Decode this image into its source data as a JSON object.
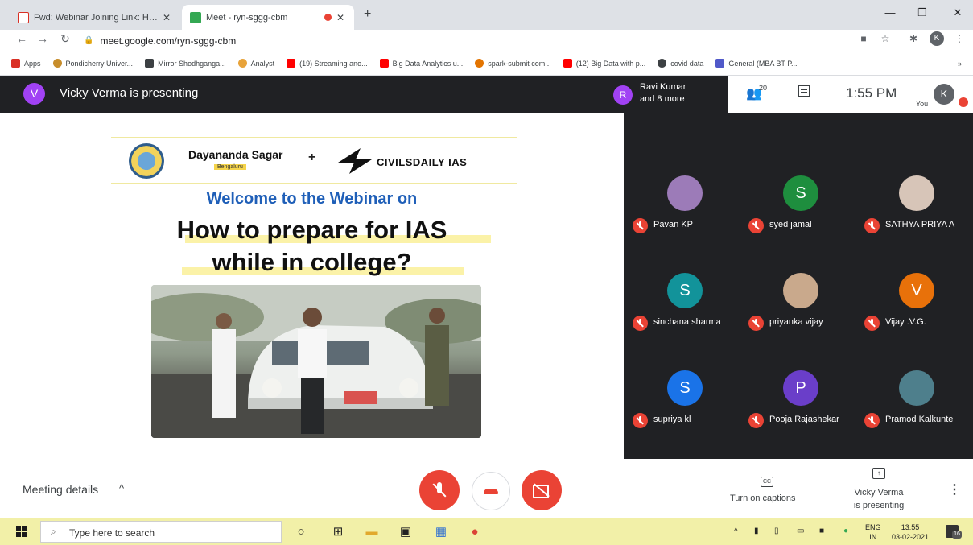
{
  "browser": {
    "tabs": [
      {
        "label": "Fwd: Webinar Joining Link: How t",
        "favicon": "gmail-icon"
      },
      {
        "label": "Meet - ryn-sggg-cbm",
        "favicon": "meet-icon",
        "recording": true
      }
    ],
    "new_tab_glyph": "+",
    "url": "meet.google.com/ryn-sggg-cbm",
    "profile_initial": "K",
    "bookmarks": [
      {
        "label": "Apps",
        "icon": "apps-grid-icon",
        "color": "#d93025"
      },
      {
        "label": "Pondicherry Univer...",
        "icon": "pondicherry-icon",
        "color": "#c78d2b"
      },
      {
        "label": "Mirror Shodhganga...",
        "icon": "shodhganga-icon",
        "color": "#3c4043"
      },
      {
        "label": "Analyst",
        "icon": "analyst-icon",
        "color": "#e8a33a"
      },
      {
        "label": "(19) Streaming ano...",
        "icon": "youtube-icon",
        "color": "#ff0000"
      },
      {
        "label": "Big Data Analytics u...",
        "icon": "youtube-icon",
        "color": "#ff0000"
      },
      {
        "label": "spark-submit com...",
        "icon": "spark-icon",
        "color": "#e37400"
      },
      {
        "label": "(12) Big Data with p...",
        "icon": "youtube-icon",
        "color": "#ff0000"
      },
      {
        "label": "covid data",
        "icon": "globe-icon",
        "color": "#3c4043"
      },
      {
        "label": "General (MBA BT P...",
        "icon": "teams-icon",
        "color": "#5059c9"
      }
    ],
    "bookmarks_more": "»"
  },
  "meet": {
    "presenter_initial": "V",
    "presenter_text": "Vicky Verma is presenting",
    "ravi_initial": "R",
    "ravi_line1": "Ravi Kumar",
    "ravi_line2": "and 8 more",
    "people_count": "20",
    "time": "1:55 PM",
    "you_label": "You",
    "you_initial": "K",
    "participants": [
      {
        "name": "Pavan KP",
        "initial": "",
        "color": "#9c7bb8",
        "photo": true
      },
      {
        "name": "syed jamal",
        "initial": "S",
        "color": "#1e8e3e",
        "photo": false
      },
      {
        "name": "SATHYA PRIYA A",
        "initial": "",
        "color": "#d7c5b8",
        "photo": true
      },
      {
        "name": "sinchana sharma",
        "initial": "S",
        "color": "#12939a",
        "photo": false
      },
      {
        "name": "priyanka vijay",
        "initial": "",
        "color": "#c9a98c",
        "photo": true
      },
      {
        "name": "Vijay .V.G.",
        "initial": "V",
        "color": "#e8710a",
        "photo": false
      },
      {
        "name": "supriya kl",
        "initial": "S",
        "color": "#1a73e8",
        "photo": false
      },
      {
        "name": "Pooja Rajashekar",
        "initial": "P",
        "color": "#6a3ec9",
        "photo": false
      },
      {
        "name": "Pramod Kalkunte",
        "initial": "",
        "color": "#4e7f8c",
        "photo": true
      }
    ],
    "meeting_details": "Meeting details",
    "details_chevron": "^",
    "captions_label": "Turn on captions",
    "cc_glyph": "CC",
    "present_line1": "Vicky Verma",
    "present_line2": "is presenting",
    "more_glyph": "⋮"
  },
  "slide": {
    "org1": "Dayananda Sagar",
    "org1_sub": "Bengaluru",
    "plus": "+",
    "org2": "CIVILSDAILY IAS",
    "welcome": "Welcome to the Webinar on",
    "headline_1": "How to prepare for IAS",
    "headline_2": "while in college?"
  },
  "taskbar": {
    "search_placeholder": "Type here to search",
    "lang_1": "ENG",
    "lang_2": "IN",
    "clock_time": "13:55",
    "clock_date": "03-02-2021",
    "notif_count": "16"
  },
  "colors": {
    "meet_dark": "#202124",
    "mute_red": "#ea4335",
    "accent_blue": "#1f5fb8",
    "taskbar_yellow": "#f2f0a8"
  }
}
